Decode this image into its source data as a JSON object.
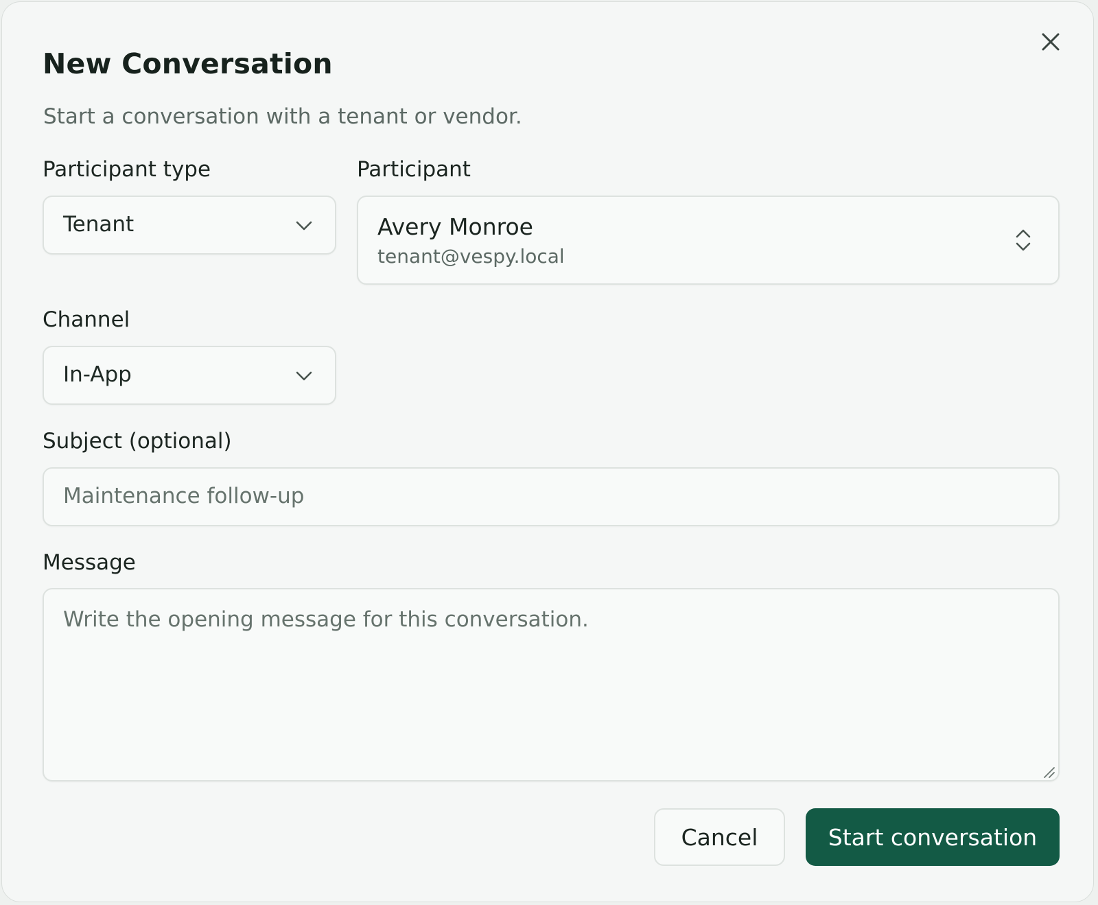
{
  "dialog": {
    "title": "New Conversation",
    "subtitle": "Start a conversation with a tenant or vendor."
  },
  "participant_type": {
    "label": "Participant type",
    "value": "Tenant"
  },
  "participant": {
    "label": "Participant",
    "name": "Avery Monroe",
    "email": "tenant@vespy.local"
  },
  "channel": {
    "label": "Channel",
    "value": "In-App"
  },
  "subject": {
    "label": "Subject (optional)",
    "placeholder": "Maintenance follow-up"
  },
  "message": {
    "label": "Message",
    "placeholder": "Write the opening message for this conversation."
  },
  "actions": {
    "cancel_label": "Cancel",
    "start_label": "Start conversation"
  },
  "colors": {
    "primary": "#135a45",
    "background": "#f5f7f6",
    "border": "#dde2df",
    "text": "#17221d",
    "muted": "#5c6964"
  },
  "icons": {
    "close": "close-icon",
    "dropdown": "chevron-down-icon",
    "combobox": "chevron-up-down-icon",
    "resize": "resize-grip-icon"
  }
}
